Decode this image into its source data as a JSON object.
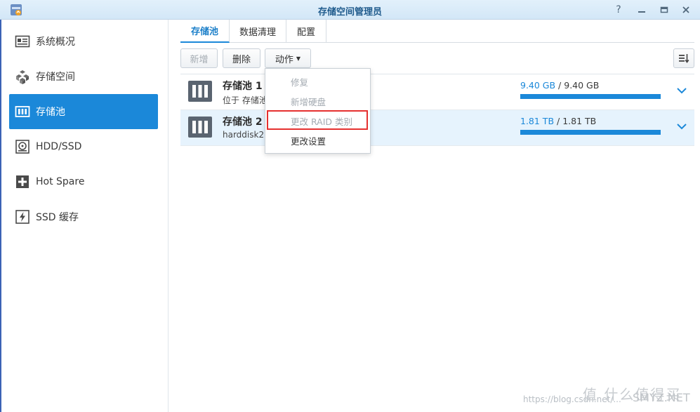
{
  "window": {
    "title": "存储空间管理员",
    "help": "?",
    "minimize": "▬",
    "maximize": "▭",
    "close": "✕"
  },
  "sidebar": {
    "items": [
      {
        "label": "系统概况",
        "icon": "overview-icon"
      },
      {
        "label": "存储空间",
        "icon": "volume-icon"
      },
      {
        "label": "存储池",
        "icon": "storage-pool-icon",
        "active": true
      },
      {
        "label": "HDD/SSD",
        "icon": "hdd-icon"
      },
      {
        "label": "Hot Spare",
        "icon": "hot-spare-icon"
      },
      {
        "label": "SSD 缓存",
        "icon": "ssd-cache-icon"
      }
    ]
  },
  "tabs": [
    {
      "label": "存储池",
      "active": true
    },
    {
      "label": "数据清理"
    },
    {
      "label": "配置"
    }
  ],
  "toolbar": {
    "new_label": "新增",
    "delete_label": "删除",
    "action_label": "动作",
    "action_caret": "▼"
  },
  "pools": [
    {
      "title": "存储池 1",
      "subtitle": "位于 存储池",
      "used": "9.40 GB",
      "sep": " / ",
      "total": "9.40 GB",
      "fill_pct": 100
    },
    {
      "title": "存储池 2",
      "subtitle": "harddisk2",
      "used": "1.81 TB",
      "sep": " / ",
      "total": "1.81 TB",
      "fill_pct": 100,
      "selected": true
    }
  ],
  "action_menu": {
    "items": [
      {
        "label": "修复",
        "enabled": false
      },
      {
        "label": "新增硬盘",
        "enabled": false
      },
      {
        "label": "更改 RAID 类别",
        "enabled": false,
        "highlighted": true
      },
      {
        "label": "更改设置",
        "enabled": true
      }
    ]
  },
  "watermark": {
    "url": "https://blog.csdn.net/...",
    "brand": "值 什么值得买",
    "site": "SMYZ.NET"
  },
  "colors": {
    "accent": "#1b88d9",
    "highlight_box": "#e5302f",
    "frame": "#3b62b5"
  }
}
